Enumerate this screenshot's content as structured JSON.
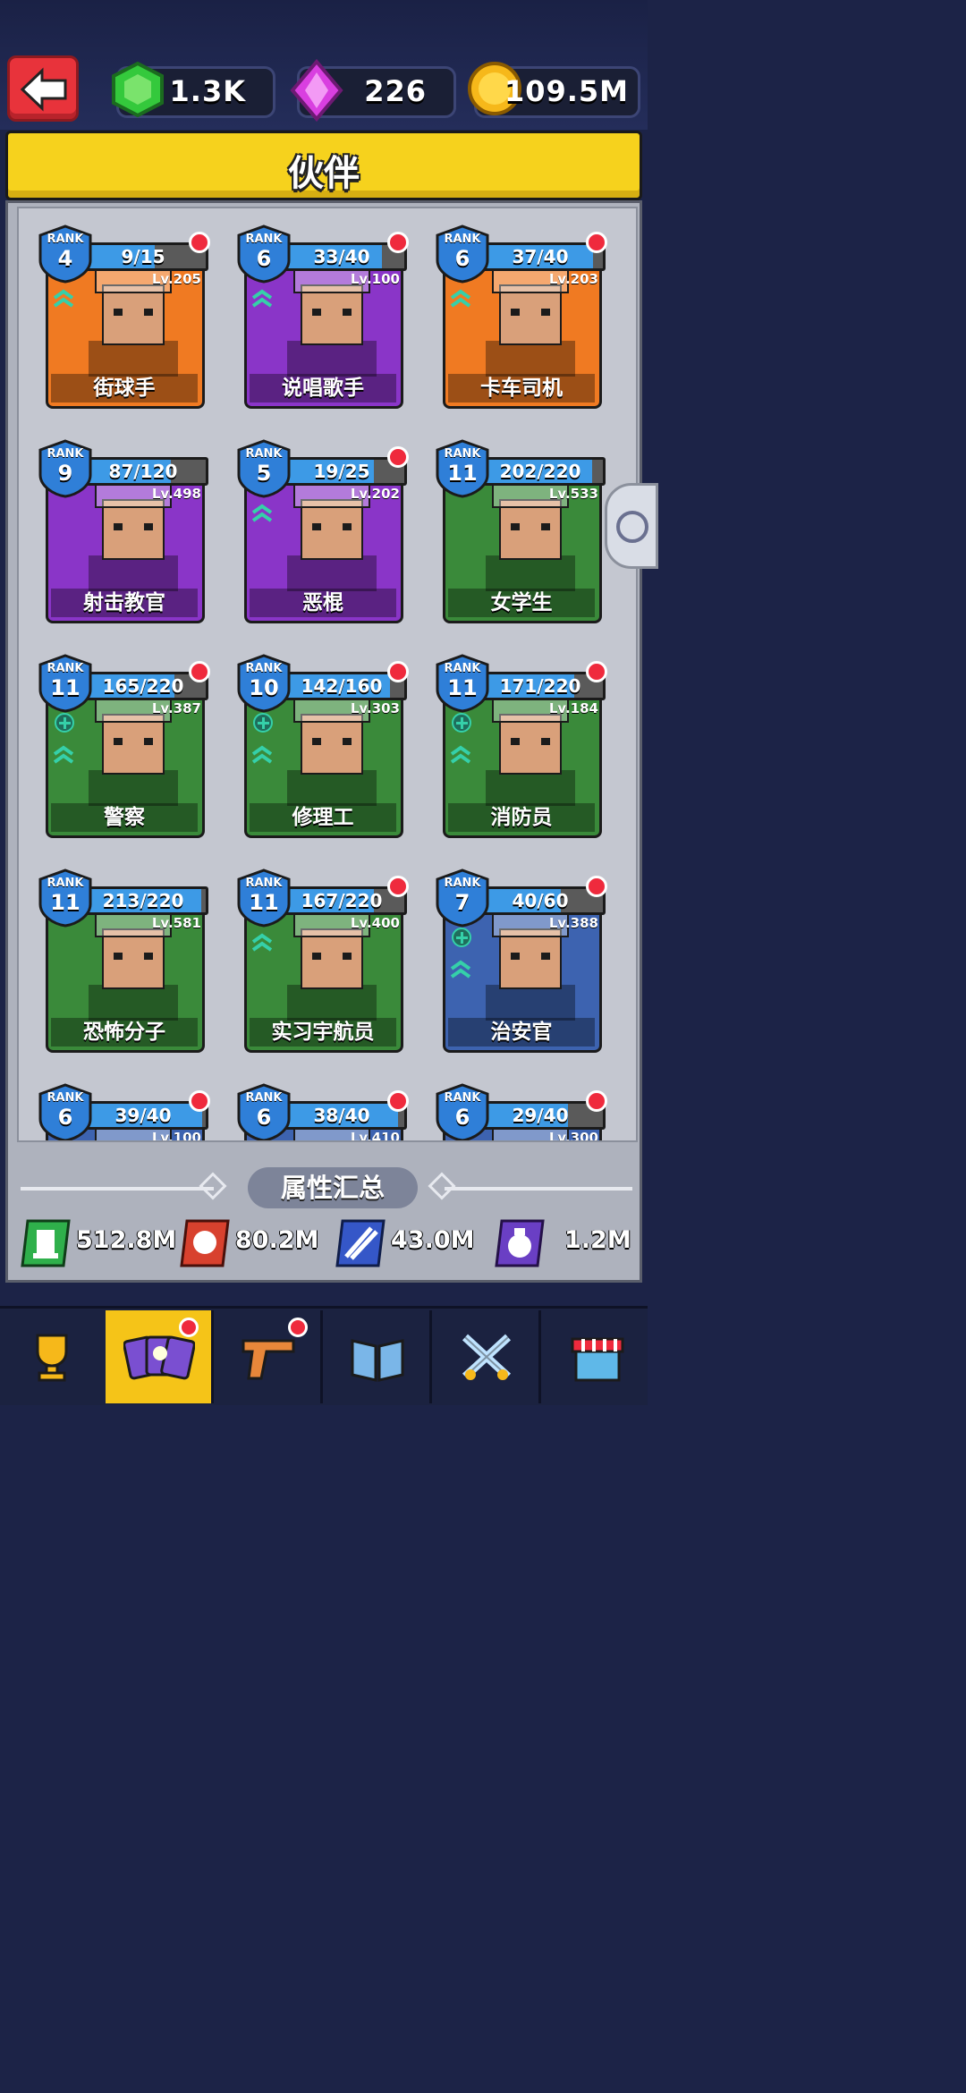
{
  "currency": {
    "gems": "1.3K",
    "crystals": "226",
    "coins": "109.5M"
  },
  "title": "伙伴",
  "rank_label": "RANK",
  "cards": [
    {
      "rank": "4",
      "progress": "9/15",
      "fill": 0.6,
      "level": "Lv.205",
      "name": "街球手",
      "bg": "#f07a22",
      "dot": true,
      "chevron": true,
      "plus": false
    },
    {
      "rank": "6",
      "progress": "33/40",
      "fill": 0.825,
      "level": "Lv.100",
      "name": "说唱歌手",
      "bg": "#8a35c8",
      "dot": true,
      "chevron": true,
      "plus": false
    },
    {
      "rank": "6",
      "progress": "37/40",
      "fill": 0.925,
      "level": "Lv.203",
      "name": "卡车司机",
      "bg": "#f07a22",
      "dot": true,
      "chevron": true,
      "plus": false
    },
    {
      "rank": "9",
      "progress": "87/120",
      "fill": 0.725,
      "level": "Lv.498",
      "name": "射击教官",
      "bg": "#8a35c8",
      "dot": false,
      "chevron": false,
      "plus": false
    },
    {
      "rank": "5",
      "progress": "19/25",
      "fill": 0.76,
      "level": "Lv.202",
      "name": "恶棍",
      "bg": "#8a35c8",
      "dot": true,
      "chevron": true,
      "plus": false
    },
    {
      "rank": "11",
      "progress": "202/220",
      "fill": 0.918,
      "level": "Lv.533",
      "name": "女学生",
      "bg": "#3a8a3a",
      "dot": false,
      "chevron": false,
      "plus": false
    },
    {
      "rank": "11",
      "progress": "165/220",
      "fill": 0.75,
      "level": "Lv.387",
      "name": "警察",
      "bg": "#3a8a3a",
      "dot": true,
      "chevron": true,
      "plus": true
    },
    {
      "rank": "10",
      "progress": "142/160",
      "fill": 0.8875,
      "level": "Lv.303",
      "name": "修理工",
      "bg": "#3a8a3a",
      "dot": true,
      "chevron": true,
      "plus": true
    },
    {
      "rank": "11",
      "progress": "171/220",
      "fill": 0.777,
      "level": "Lv.184",
      "name": "消防员",
      "bg": "#3a8a3a",
      "dot": true,
      "chevron": true,
      "plus": true
    },
    {
      "rank": "11",
      "progress": "213/220",
      "fill": 0.968,
      "level": "Lv.581",
      "name": "恐怖分子",
      "bg": "#3a8a3a",
      "dot": false,
      "chevron": false,
      "plus": false
    },
    {
      "rank": "11",
      "progress": "167/220",
      "fill": 0.759,
      "level": "Lv.400",
      "name": "实习宇航员",
      "bg": "#3a8a3a",
      "dot": true,
      "chevron": true,
      "plus": false
    },
    {
      "rank": "7",
      "progress": "40/60",
      "fill": 0.667,
      "level": "Lv.388",
      "name": "治安官",
      "bg": "#3d63b0",
      "dot": true,
      "chevron": true,
      "plus": true
    },
    {
      "rank": "6",
      "progress": "39/40",
      "fill": 0.975,
      "level": "Lv.100",
      "name": "",
      "bg": "#3d63b0",
      "dot": true,
      "chevron": false,
      "plus": false
    },
    {
      "rank": "6",
      "progress": "38/40",
      "fill": 0.95,
      "level": "Lv.410",
      "name": "",
      "bg": "#3d63b0",
      "dot": true,
      "chevron": false,
      "plus": false
    },
    {
      "rank": "6",
      "progress": "29/40",
      "fill": 0.725,
      "level": "Lv.300",
      "name": "",
      "bg": "#3d63b0",
      "dot": true,
      "chevron": false,
      "plus": false
    }
  ],
  "summary": {
    "title": "属性汇总",
    "stats": [
      {
        "icon": "tower-icon",
        "value": "512.8M",
        "color": "#2fb04b"
      },
      {
        "icon": "fist-icon",
        "value": "80.2M",
        "color": "#d8412e"
      },
      {
        "icon": "auto-icon",
        "value": "43.0M",
        "color": "#3557c8"
      },
      {
        "icon": "money-bag-icon",
        "value": "1.2M",
        "color": "#6a3fc4"
      }
    ]
  },
  "nav": [
    {
      "name": "trophy",
      "active": false,
      "dot": false
    },
    {
      "name": "partners",
      "active": true,
      "dot": true
    },
    {
      "name": "weapons",
      "active": false,
      "dot": true
    },
    {
      "name": "book",
      "active": false,
      "dot": false
    },
    {
      "name": "battle",
      "active": false,
      "dot": false
    },
    {
      "name": "shop",
      "active": false,
      "dot": false
    }
  ]
}
